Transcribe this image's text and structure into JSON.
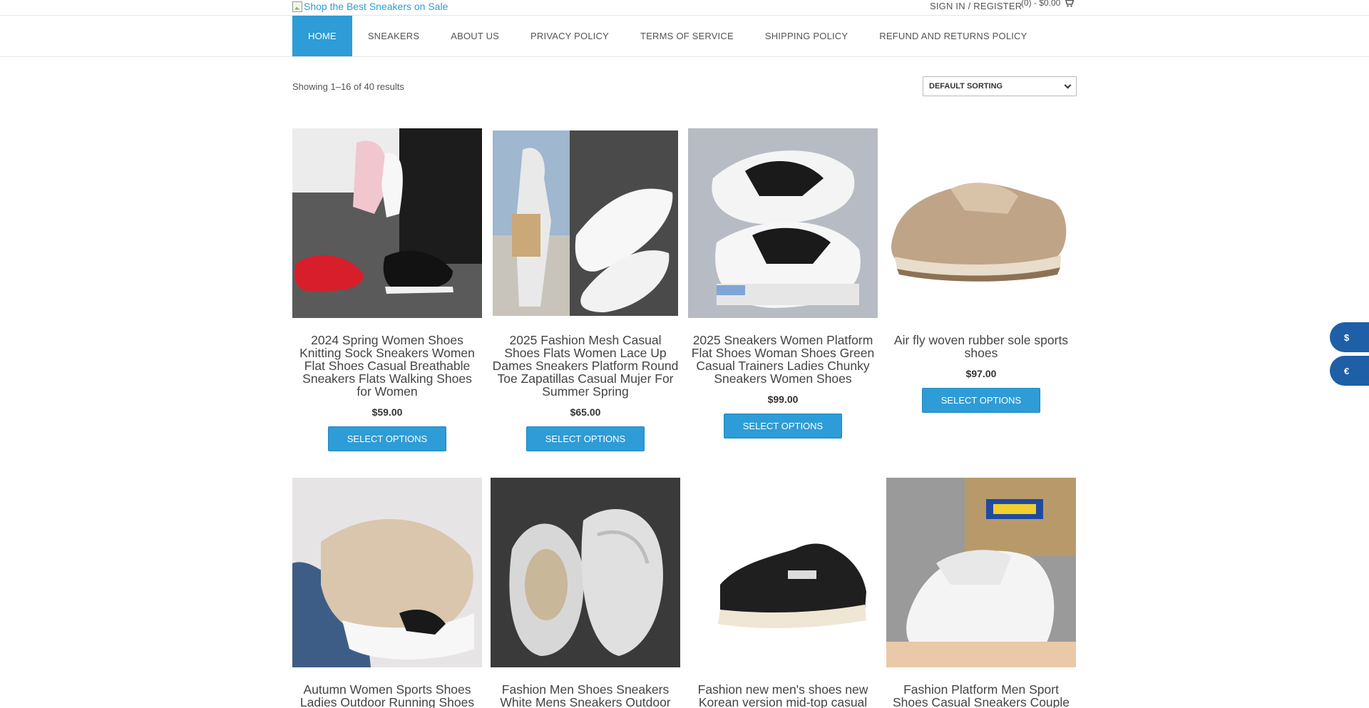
{
  "header": {
    "logo_alt": "Shop the Best Sneakers on Sale",
    "signin": "SIGN IN / REGISTER",
    "cart": "(0) - $0.00"
  },
  "nav": {
    "items": [
      {
        "label": "HOME"
      },
      {
        "label": "SNEAKERS"
      },
      {
        "label": "ABOUT US"
      },
      {
        "label": "PRIVACY POLICY"
      },
      {
        "label": "TERMS OF SERVICE"
      },
      {
        "label": "SHIPPING POLICY"
      },
      {
        "label": "REFUND AND RETURNS POLICY"
      }
    ]
  },
  "shop": {
    "results": "Showing 1–16 of 40 results",
    "sort": "DEFAULT SORTING"
  },
  "products": [
    {
      "title": "2024 Spring Women Shoes Knitting Sock Sneakers Women Flat Shoes Casual Breathable Sneakers Flats Walking Shoes for Women",
      "price": "$59.00",
      "button": "SELECT OPTIONS"
    },
    {
      "title": "2025 Fashion Mesh Casual Shoes Flats Women Lace Up Dames Sneakers Platform Round Toe Zapatillas Casual Mujer For Summer Spring",
      "price": "$65.00",
      "button": "SELECT OPTIONS"
    },
    {
      "title": "2025 Sneakers Women Platform Flat Shoes Woman Shoes Green Casual Trainers Ladies Chunky Sneakers Women Shoes",
      "price": "$99.00",
      "button": "SELECT OPTIONS"
    },
    {
      "title": "Air fly woven rubber sole sports shoes",
      "price": "$97.00",
      "button": "SELECT OPTIONS"
    },
    {
      "title": "Autumn Women Sports Shoes Ladies Outdoor Running Shoes"
    },
    {
      "title": "Fashion Men Shoes Sneakers White Mens Sneakers Outdoor"
    },
    {
      "title": "Fashion new men's shoes new Korean version mid-top casual"
    },
    {
      "title": "Fashion Platform Men Sport Shoes Casual Sneakers Couple"
    }
  ],
  "currency": {
    "usd": "$",
    "eur": "€"
  }
}
